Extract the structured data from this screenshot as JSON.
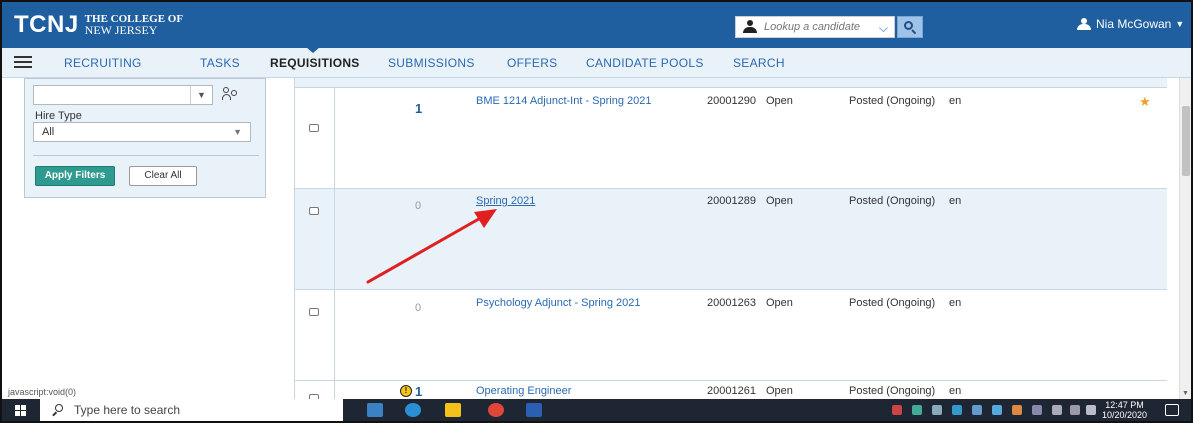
{
  "header": {
    "logo_main": "TCNJ",
    "logo_sub1": "THE COLLEGE OF",
    "logo_sub2": "NEW JERSEY",
    "search_placeholder": "Lookup a candidate",
    "user_name": "Nia McGowan"
  },
  "nav": {
    "tabs": [
      {
        "label": "RECRUITING"
      },
      {
        "label": "TASKS"
      },
      {
        "label": "REQUISITIONS",
        "active": true
      },
      {
        "label": "SUBMISSIONS"
      },
      {
        "label": "OFFERS"
      },
      {
        "label": "CANDIDATE POOLS"
      },
      {
        "label": "SEARCH"
      }
    ]
  },
  "filters": {
    "recruiter_value": "",
    "hire_type_label": "Hire Type",
    "hire_type_value": "All",
    "apply_label": "Apply Filters",
    "clear_label": "Clear All"
  },
  "status_bar_url": "javascript:void(0)",
  "requisitions": [
    {
      "count": "1",
      "title": "BME 1214 Adjunct-Int - Spring 2021",
      "req_id": "20001290",
      "status": "Open",
      "posting": "Posted (Ongoing)",
      "lang": "en",
      "starred": true
    },
    {
      "count": "0",
      "title": "Spring 2021",
      "req_id": "20001289",
      "status": "Open",
      "posting": "Posted (Ongoing)",
      "lang": "en",
      "highlighted": true
    },
    {
      "count": "0",
      "title": "Psychology Adjunct - Spring 2021",
      "req_id": "20001263",
      "status": "Open",
      "posting": "Posted (Ongoing)",
      "lang": "en"
    },
    {
      "count": "1",
      "title": "Operating Engineer",
      "req_id": "20001261",
      "status": "Open",
      "posting": "Posted (Ongoing)",
      "lang": "en",
      "warning": true
    }
  ],
  "taskbar": {
    "search_placeholder": "Type here to search",
    "time": "12:47 PM",
    "date": "10/20/2020"
  },
  "colors": {
    "header_bg": "#1f5f9f",
    "nav_bg": "#e9f1f9",
    "link": "#2a6ab0",
    "apply_button": "#2f9a8f",
    "annotation_arrow": "#e02020",
    "star": "#f0a020"
  }
}
